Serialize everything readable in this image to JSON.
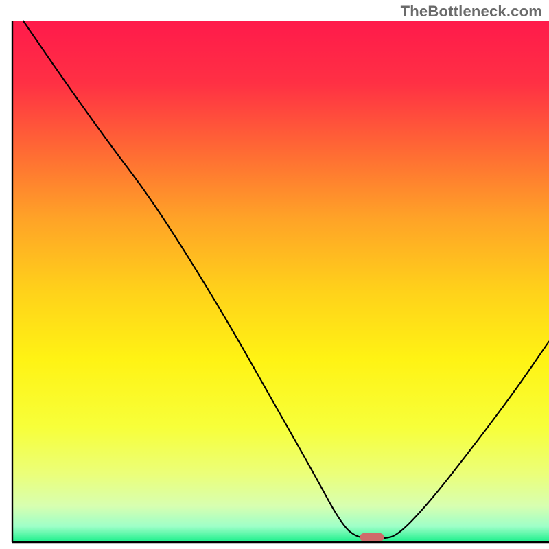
{
  "watermark": "TheBottleneck.com",
  "chart_data": {
    "type": "line",
    "title": "",
    "xlabel": "",
    "ylabel": "",
    "xlim": [
      0,
      100
    ],
    "ylim": [
      0,
      100
    ],
    "grid": false,
    "legend": false,
    "background": {
      "gradient_stops": [
        {
          "pos": 0.0,
          "color": "#ff1a4b"
        },
        {
          "pos": 0.12,
          "color": "#ff3044"
        },
        {
          "pos": 0.25,
          "color": "#ff6a34"
        },
        {
          "pos": 0.38,
          "color": "#ffa327"
        },
        {
          "pos": 0.52,
          "color": "#ffd21a"
        },
        {
          "pos": 0.65,
          "color": "#fff314"
        },
        {
          "pos": 0.78,
          "color": "#f7ff3a"
        },
        {
          "pos": 0.87,
          "color": "#ebff7a"
        },
        {
          "pos": 0.93,
          "color": "#d8ffb0"
        },
        {
          "pos": 0.97,
          "color": "#9effc8"
        },
        {
          "pos": 1.0,
          "color": "#19ef8a"
        }
      ]
    },
    "series": [
      {
        "name": "bottleneck-curve",
        "points": [
          {
            "x": 2.0,
            "y": 100.0
          },
          {
            "x": 10.0,
            "y": 88.0
          },
          {
            "x": 18.0,
            "y": 76.5
          },
          {
            "x": 25.0,
            "y": 67.0
          },
          {
            "x": 32.0,
            "y": 56.0
          },
          {
            "x": 40.0,
            "y": 42.5
          },
          {
            "x": 48.0,
            "y": 28.0
          },
          {
            "x": 56.0,
            "y": 13.5
          },
          {
            "x": 61.0,
            "y": 4.0
          },
          {
            "x": 64.0,
            "y": 0.8
          },
          {
            "x": 69.0,
            "y": 0.6
          },
          {
            "x": 72.0,
            "y": 1.4
          },
          {
            "x": 78.0,
            "y": 8.0
          },
          {
            "x": 86.0,
            "y": 18.5
          },
          {
            "x": 94.0,
            "y": 29.5
          },
          {
            "x": 100.0,
            "y": 38.5
          }
        ]
      }
    ],
    "marker": {
      "name": "optimal-marker",
      "x": 67.0,
      "y": 0.0,
      "color": "#cf6a6a",
      "width_pct": 4.5,
      "height_pct": 1.6
    },
    "axes": {
      "left": {
        "x": 2.0,
        "y0": 0,
        "y1": 100
      },
      "bottom": {
        "y": 0.0,
        "x0": 2,
        "x1": 100
      }
    }
  }
}
